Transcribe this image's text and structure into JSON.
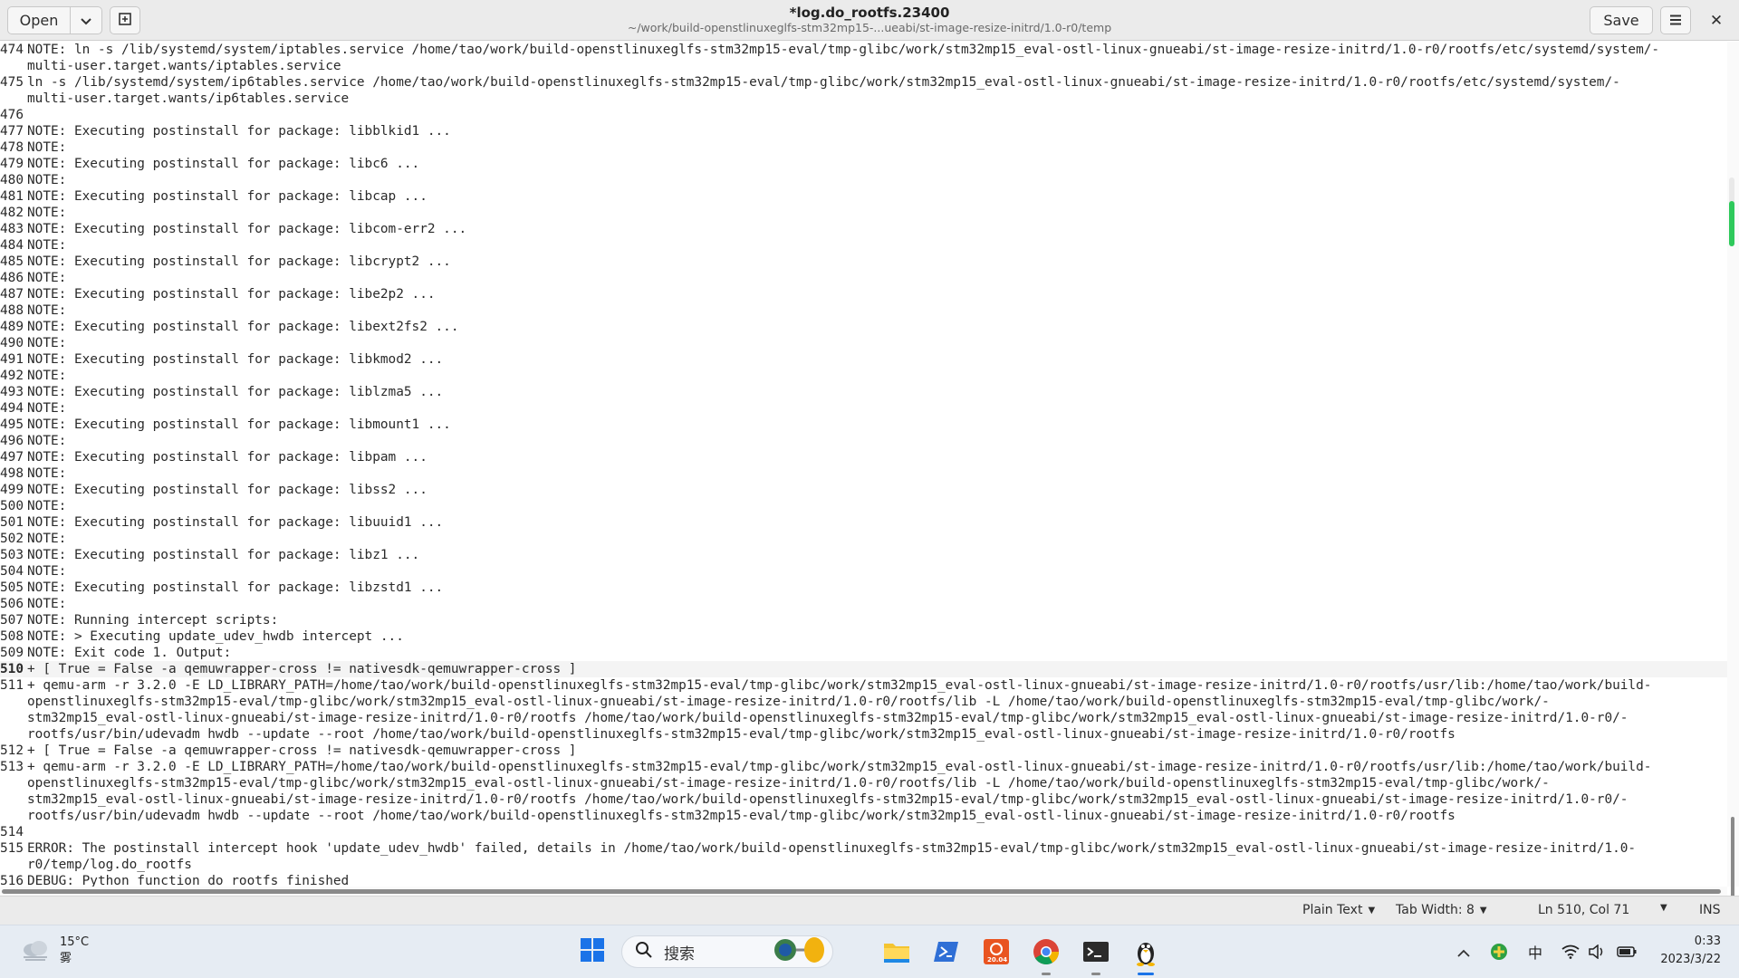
{
  "header": {
    "title": "*log.do_rootfs.23400",
    "subtitle": "~/work/build-openstlinuxeglfs-stm32mp15-...ueabi/st-image-resize-initrd/1.0-r0/temp",
    "open_label": "Open",
    "save_label": "Save",
    "close_glyph": "✕"
  },
  "editor": {
    "lines": [
      {
        "num": "474",
        "rows": [
          "NOTE: ln -s /lib/systemd/system/iptables.service /home/tao/work/build-openstlinuxeglfs-stm32mp15-eval/tmp-glibc/work/stm32mp15_eval-ostl-linux-gnueabi/st-image-resize-initrd/1.0-r0/rootfs/etc/systemd/system/-",
          "multi-user.target.wants/iptables.service"
        ]
      },
      {
        "num": "475",
        "rows": [
          "ln -s /lib/systemd/system/ip6tables.service /home/tao/work/build-openstlinuxeglfs-stm32mp15-eval/tmp-glibc/work/stm32mp15_eval-ostl-linux-gnueabi/st-image-resize-initrd/1.0-r0/rootfs/etc/systemd/system/-",
          "multi-user.target.wants/ip6tables.service"
        ]
      },
      {
        "num": "476",
        "rows": [
          ""
        ]
      },
      {
        "num": "477",
        "rows": [
          "NOTE: Executing postinstall for package: libblkid1 ..."
        ]
      },
      {
        "num": "478",
        "rows": [
          "NOTE:"
        ]
      },
      {
        "num": "479",
        "rows": [
          "NOTE: Executing postinstall for package: libc6 ..."
        ]
      },
      {
        "num": "480",
        "rows": [
          "NOTE:"
        ]
      },
      {
        "num": "481",
        "rows": [
          "NOTE: Executing postinstall for package: libcap ..."
        ]
      },
      {
        "num": "482",
        "rows": [
          "NOTE:"
        ]
      },
      {
        "num": "483",
        "rows": [
          "NOTE: Executing postinstall for package: libcom-err2 ..."
        ]
      },
      {
        "num": "484",
        "rows": [
          "NOTE:"
        ]
      },
      {
        "num": "485",
        "rows": [
          "NOTE: Executing postinstall for package: libcrypt2 ..."
        ]
      },
      {
        "num": "486",
        "rows": [
          "NOTE:"
        ]
      },
      {
        "num": "487",
        "rows": [
          "NOTE: Executing postinstall for package: libe2p2 ..."
        ]
      },
      {
        "num": "488",
        "rows": [
          "NOTE:"
        ]
      },
      {
        "num": "489",
        "rows": [
          "NOTE: Executing postinstall for package: libext2fs2 ..."
        ]
      },
      {
        "num": "490",
        "rows": [
          "NOTE:"
        ]
      },
      {
        "num": "491",
        "rows": [
          "NOTE: Executing postinstall for package: libkmod2 ..."
        ]
      },
      {
        "num": "492",
        "rows": [
          "NOTE:"
        ]
      },
      {
        "num": "493",
        "rows": [
          "NOTE: Executing postinstall for package: liblzma5 ..."
        ]
      },
      {
        "num": "494",
        "rows": [
          "NOTE:"
        ]
      },
      {
        "num": "495",
        "rows": [
          "NOTE: Executing postinstall for package: libmount1 ..."
        ]
      },
      {
        "num": "496",
        "rows": [
          "NOTE:"
        ]
      },
      {
        "num": "497",
        "rows": [
          "NOTE: Executing postinstall for package: libpam ..."
        ]
      },
      {
        "num": "498",
        "rows": [
          "NOTE:"
        ]
      },
      {
        "num": "499",
        "rows": [
          "NOTE: Executing postinstall for package: libss2 ..."
        ]
      },
      {
        "num": "500",
        "rows": [
          "NOTE:"
        ]
      },
      {
        "num": "501",
        "rows": [
          "NOTE: Executing postinstall for package: libuuid1 ..."
        ]
      },
      {
        "num": "502",
        "rows": [
          "NOTE:"
        ]
      },
      {
        "num": "503",
        "rows": [
          "NOTE: Executing postinstall for package: libz1 ..."
        ]
      },
      {
        "num": "504",
        "rows": [
          "NOTE:"
        ]
      },
      {
        "num": "505",
        "rows": [
          "NOTE: Executing postinstall for package: libzstd1 ..."
        ]
      },
      {
        "num": "506",
        "rows": [
          "NOTE:"
        ]
      },
      {
        "num": "507",
        "rows": [
          "NOTE: Running intercept scripts:"
        ]
      },
      {
        "num": "508",
        "rows": [
          "NOTE: > Executing update_udev_hwdb intercept ..."
        ]
      },
      {
        "num": "509",
        "rows": [
          "NOTE: Exit code 1. Output:"
        ]
      },
      {
        "num": "510",
        "current": true,
        "rows": [
          "+ [ True = False -a qemuwrapper-cross != nativesdk-qemuwrapper-cross ]"
        ]
      },
      {
        "num": "511",
        "rows": [
          "+ qemu-arm -r 3.2.0 -E LD_LIBRARY_PATH=/home/tao/work/build-openstlinuxeglfs-stm32mp15-eval/tmp-glibc/work/stm32mp15_eval-ostl-linux-gnueabi/st-image-resize-initrd/1.0-r0/rootfs/usr/lib:/home/tao/work/build-",
          "openstlinuxeglfs-stm32mp15-eval/tmp-glibc/work/stm32mp15_eval-ostl-linux-gnueabi/st-image-resize-initrd/1.0-r0/rootfs/lib -L /home/tao/work/build-openstlinuxeglfs-stm32mp15-eval/tmp-glibc/work/-",
          "stm32mp15_eval-ostl-linux-gnueabi/st-image-resize-initrd/1.0-r0/rootfs /home/tao/work/build-openstlinuxeglfs-stm32mp15-eval/tmp-glibc/work/stm32mp15_eval-ostl-linux-gnueabi/st-image-resize-initrd/1.0-r0/-",
          "rootfs/usr/bin/udevadm hwdb --update --root /home/tao/work/build-openstlinuxeglfs-stm32mp15-eval/tmp-glibc/work/stm32mp15_eval-ostl-linux-gnueabi/st-image-resize-initrd/1.0-r0/rootfs"
        ]
      },
      {
        "num": "512",
        "rows": [
          "+ [ True = False -a qemuwrapper-cross != nativesdk-qemuwrapper-cross ]"
        ]
      },
      {
        "num": "513",
        "rows": [
          "+ qemu-arm -r 3.2.0 -E LD_LIBRARY_PATH=/home/tao/work/build-openstlinuxeglfs-stm32mp15-eval/tmp-glibc/work/stm32mp15_eval-ostl-linux-gnueabi/st-image-resize-initrd/1.0-r0/rootfs/usr/lib:/home/tao/work/build-",
          "openstlinuxeglfs-stm32mp15-eval/tmp-glibc/work/stm32mp15_eval-ostl-linux-gnueabi/st-image-resize-initrd/1.0-r0/rootfs/lib -L /home/tao/work/build-openstlinuxeglfs-stm32mp15-eval/tmp-glibc/work/-",
          "stm32mp15_eval-ostl-linux-gnueabi/st-image-resize-initrd/1.0-r0/rootfs /home/tao/work/build-openstlinuxeglfs-stm32mp15-eval/tmp-glibc/work/stm32mp15_eval-ostl-linux-gnueabi/st-image-resize-initrd/1.0-r0/-",
          "rootfs/usr/bin/udevadm hwdb --update --root /home/tao/work/build-openstlinuxeglfs-stm32mp15-eval/tmp-glibc/work/stm32mp15_eval-ostl-linux-gnueabi/st-image-resize-initrd/1.0-r0/rootfs"
        ]
      },
      {
        "num": "514",
        "rows": [
          ""
        ]
      },
      {
        "num": "515",
        "rows": [
          "ERROR: The postinstall intercept hook 'update_udev_hwdb' failed, details in /home/tao/work/build-openstlinuxeglfs-stm32mp15-eval/tmp-glibc/work/stm32mp15_eval-ostl-linux-gnueabi/st-image-resize-initrd/1.0-",
          "r0/temp/log.do_rootfs"
        ]
      },
      {
        "num": "516",
        "rows": [
          "DEBUG: Python function do_rootfs finished"
        ]
      }
    ]
  },
  "statusbar": {
    "language": "Plain Text",
    "tab_width": "Tab Width: 8",
    "position": "Ln 510, Col 71",
    "mode": "INS"
  },
  "taskbar": {
    "weather_temp": "15°C",
    "weather_desc": "雾",
    "search_placeholder": "搜索",
    "ime_label": "中",
    "clock_time": "0:33",
    "clock_date": "2023/3/22",
    "ubuntu_badge": "20.04"
  },
  "colors": {
    "accent_green": "#2ec95b",
    "headerbar_bg": "#ebebeb",
    "taskbar_bg": "#e6ecf3"
  }
}
